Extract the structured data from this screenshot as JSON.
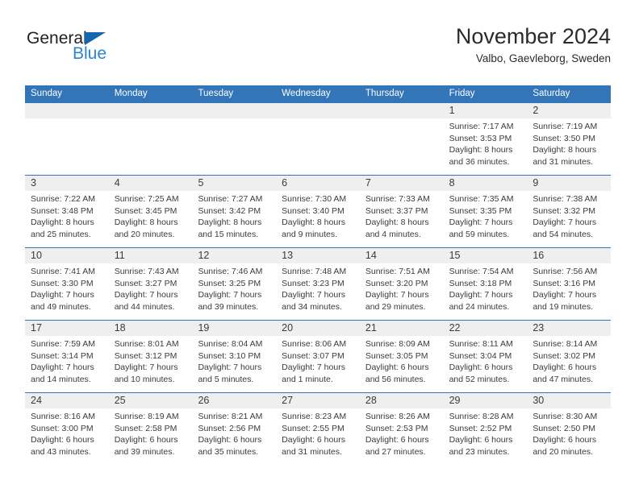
{
  "brand": {
    "name_part1": "General",
    "name_part2": "Blue",
    "triangle_color": "#1565b0",
    "blue_color": "#2a85d0"
  },
  "header": {
    "title": "November 2024",
    "subtitle": "Valbo, Gaevleborg, Sweden"
  },
  "theme": {
    "header_bg": "#3275b8",
    "day_band_bg": "#efefef",
    "text_color": "#3b3b3b"
  },
  "weekdays": [
    "Sunday",
    "Monday",
    "Tuesday",
    "Wednesday",
    "Thursday",
    "Friday",
    "Saturday"
  ],
  "weeks": [
    [
      {
        "day": "",
        "sunrise": "",
        "sunset": "",
        "daylight1": "",
        "daylight2": ""
      },
      {
        "day": "",
        "sunrise": "",
        "sunset": "",
        "daylight1": "",
        "daylight2": ""
      },
      {
        "day": "",
        "sunrise": "",
        "sunset": "",
        "daylight1": "",
        "daylight2": ""
      },
      {
        "day": "",
        "sunrise": "",
        "sunset": "",
        "daylight1": "",
        "daylight2": ""
      },
      {
        "day": "",
        "sunrise": "",
        "sunset": "",
        "daylight1": "",
        "daylight2": ""
      },
      {
        "day": "1",
        "sunrise": "Sunrise: 7:17 AM",
        "sunset": "Sunset: 3:53 PM",
        "daylight1": "Daylight: 8 hours",
        "daylight2": "and 36 minutes."
      },
      {
        "day": "2",
        "sunrise": "Sunrise: 7:19 AM",
        "sunset": "Sunset: 3:50 PM",
        "daylight1": "Daylight: 8 hours",
        "daylight2": "and 31 minutes."
      }
    ],
    [
      {
        "day": "3",
        "sunrise": "Sunrise: 7:22 AM",
        "sunset": "Sunset: 3:48 PM",
        "daylight1": "Daylight: 8 hours",
        "daylight2": "and 25 minutes."
      },
      {
        "day": "4",
        "sunrise": "Sunrise: 7:25 AM",
        "sunset": "Sunset: 3:45 PM",
        "daylight1": "Daylight: 8 hours",
        "daylight2": "and 20 minutes."
      },
      {
        "day": "5",
        "sunrise": "Sunrise: 7:27 AM",
        "sunset": "Sunset: 3:42 PM",
        "daylight1": "Daylight: 8 hours",
        "daylight2": "and 15 minutes."
      },
      {
        "day": "6",
        "sunrise": "Sunrise: 7:30 AM",
        "sunset": "Sunset: 3:40 PM",
        "daylight1": "Daylight: 8 hours",
        "daylight2": "and 9 minutes."
      },
      {
        "day": "7",
        "sunrise": "Sunrise: 7:33 AM",
        "sunset": "Sunset: 3:37 PM",
        "daylight1": "Daylight: 8 hours",
        "daylight2": "and 4 minutes."
      },
      {
        "day": "8",
        "sunrise": "Sunrise: 7:35 AM",
        "sunset": "Sunset: 3:35 PM",
        "daylight1": "Daylight: 7 hours",
        "daylight2": "and 59 minutes."
      },
      {
        "day": "9",
        "sunrise": "Sunrise: 7:38 AM",
        "sunset": "Sunset: 3:32 PM",
        "daylight1": "Daylight: 7 hours",
        "daylight2": "and 54 minutes."
      }
    ],
    [
      {
        "day": "10",
        "sunrise": "Sunrise: 7:41 AM",
        "sunset": "Sunset: 3:30 PM",
        "daylight1": "Daylight: 7 hours",
        "daylight2": "and 49 minutes."
      },
      {
        "day": "11",
        "sunrise": "Sunrise: 7:43 AM",
        "sunset": "Sunset: 3:27 PM",
        "daylight1": "Daylight: 7 hours",
        "daylight2": "and 44 minutes."
      },
      {
        "day": "12",
        "sunrise": "Sunrise: 7:46 AM",
        "sunset": "Sunset: 3:25 PM",
        "daylight1": "Daylight: 7 hours",
        "daylight2": "and 39 minutes."
      },
      {
        "day": "13",
        "sunrise": "Sunrise: 7:48 AM",
        "sunset": "Sunset: 3:23 PM",
        "daylight1": "Daylight: 7 hours",
        "daylight2": "and 34 minutes."
      },
      {
        "day": "14",
        "sunrise": "Sunrise: 7:51 AM",
        "sunset": "Sunset: 3:20 PM",
        "daylight1": "Daylight: 7 hours",
        "daylight2": "and 29 minutes."
      },
      {
        "day": "15",
        "sunrise": "Sunrise: 7:54 AM",
        "sunset": "Sunset: 3:18 PM",
        "daylight1": "Daylight: 7 hours",
        "daylight2": "and 24 minutes."
      },
      {
        "day": "16",
        "sunrise": "Sunrise: 7:56 AM",
        "sunset": "Sunset: 3:16 PM",
        "daylight1": "Daylight: 7 hours",
        "daylight2": "and 19 minutes."
      }
    ],
    [
      {
        "day": "17",
        "sunrise": "Sunrise: 7:59 AM",
        "sunset": "Sunset: 3:14 PM",
        "daylight1": "Daylight: 7 hours",
        "daylight2": "and 14 minutes."
      },
      {
        "day": "18",
        "sunrise": "Sunrise: 8:01 AM",
        "sunset": "Sunset: 3:12 PM",
        "daylight1": "Daylight: 7 hours",
        "daylight2": "and 10 minutes."
      },
      {
        "day": "19",
        "sunrise": "Sunrise: 8:04 AM",
        "sunset": "Sunset: 3:10 PM",
        "daylight1": "Daylight: 7 hours",
        "daylight2": "and 5 minutes."
      },
      {
        "day": "20",
        "sunrise": "Sunrise: 8:06 AM",
        "sunset": "Sunset: 3:07 PM",
        "daylight1": "Daylight: 7 hours",
        "daylight2": "and 1 minute."
      },
      {
        "day": "21",
        "sunrise": "Sunrise: 8:09 AM",
        "sunset": "Sunset: 3:05 PM",
        "daylight1": "Daylight: 6 hours",
        "daylight2": "and 56 minutes."
      },
      {
        "day": "22",
        "sunrise": "Sunrise: 8:11 AM",
        "sunset": "Sunset: 3:04 PM",
        "daylight1": "Daylight: 6 hours",
        "daylight2": "and 52 minutes."
      },
      {
        "day": "23",
        "sunrise": "Sunrise: 8:14 AM",
        "sunset": "Sunset: 3:02 PM",
        "daylight1": "Daylight: 6 hours",
        "daylight2": "and 47 minutes."
      }
    ],
    [
      {
        "day": "24",
        "sunrise": "Sunrise: 8:16 AM",
        "sunset": "Sunset: 3:00 PM",
        "daylight1": "Daylight: 6 hours",
        "daylight2": "and 43 minutes."
      },
      {
        "day": "25",
        "sunrise": "Sunrise: 8:19 AM",
        "sunset": "Sunset: 2:58 PM",
        "daylight1": "Daylight: 6 hours",
        "daylight2": "and 39 minutes."
      },
      {
        "day": "26",
        "sunrise": "Sunrise: 8:21 AM",
        "sunset": "Sunset: 2:56 PM",
        "daylight1": "Daylight: 6 hours",
        "daylight2": "and 35 minutes."
      },
      {
        "day": "27",
        "sunrise": "Sunrise: 8:23 AM",
        "sunset": "Sunset: 2:55 PM",
        "daylight1": "Daylight: 6 hours",
        "daylight2": "and 31 minutes."
      },
      {
        "day": "28",
        "sunrise": "Sunrise: 8:26 AM",
        "sunset": "Sunset: 2:53 PM",
        "daylight1": "Daylight: 6 hours",
        "daylight2": "and 27 minutes."
      },
      {
        "day": "29",
        "sunrise": "Sunrise: 8:28 AM",
        "sunset": "Sunset: 2:52 PM",
        "daylight1": "Daylight: 6 hours",
        "daylight2": "and 23 minutes."
      },
      {
        "day": "30",
        "sunrise": "Sunrise: 8:30 AM",
        "sunset": "Sunset: 2:50 PM",
        "daylight1": "Daylight: 6 hours",
        "daylight2": "and 20 minutes."
      }
    ]
  ]
}
